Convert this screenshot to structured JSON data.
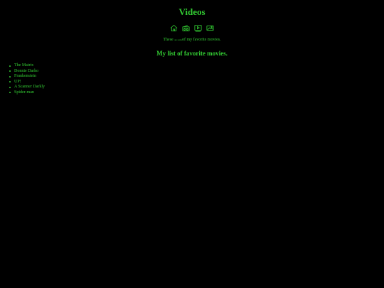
{
  "page": {
    "title": "Videos"
  },
  "nav": {
    "items": [
      {
        "icon": "home-icon"
      },
      {
        "icon": "radio-icon"
      },
      {
        "icon": "video-icon"
      },
      {
        "icon": "photo-icon"
      }
    ]
  },
  "intro": {
    "before": "These",
    "tiny": "are some",
    "after": "of my favorite movies."
  },
  "list": {
    "heading": "My list of favorite movies.",
    "movies": [
      "The Matrix",
      "Donnie Darko",
      "Frankenstein",
      "UP!",
      "A Scanner Darkly",
      "Spider-man"
    ]
  },
  "colors": {
    "background": "#000000",
    "text": "#33cc33"
  }
}
